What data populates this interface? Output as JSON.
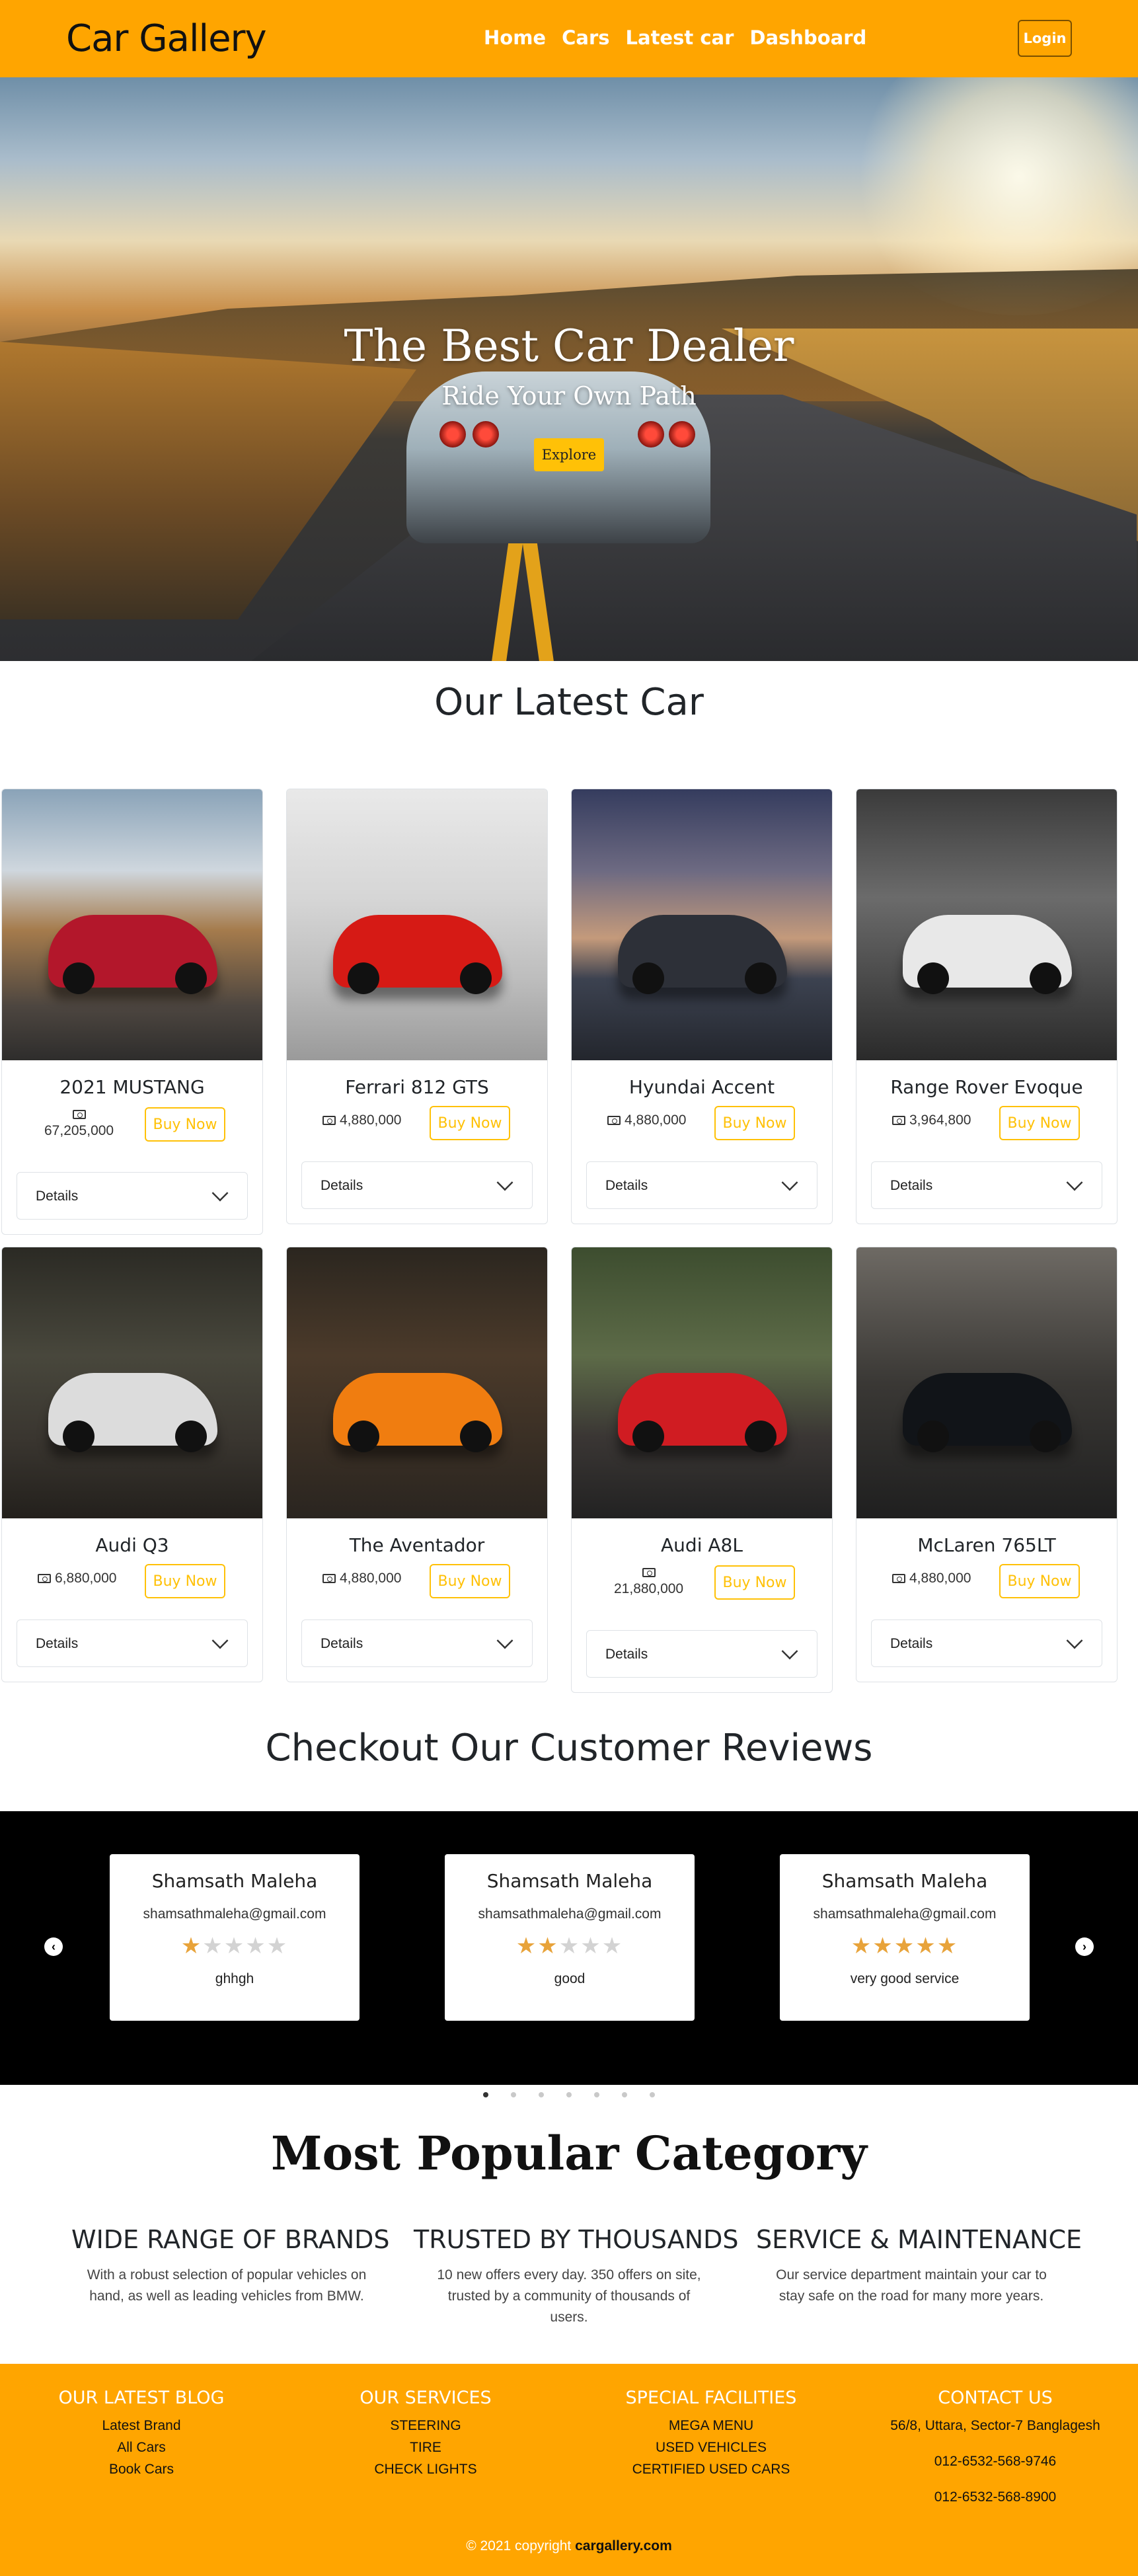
{
  "header": {
    "brand": "Car Gallery",
    "nav": [
      "Home",
      "Cars",
      "Latest car",
      "Dashboard"
    ],
    "login": "Login"
  },
  "hero": {
    "title": "The Best Car Dealer",
    "subtitle": "Ride Your Own Path",
    "button": "Explore"
  },
  "latest": {
    "title": "Our Latest Car",
    "buy_label": "Buy Now",
    "details_label": "Details",
    "cars": [
      {
        "name": "2021 MUSTANG",
        "price": "67,205,000"
      },
      {
        "name": "Ferrari 812 GTS",
        "price": "4,880,000"
      },
      {
        "name": "Hyundai Accent",
        "price": "4,880,000"
      },
      {
        "name": "Range Rover Evoque",
        "price": "3,964,800"
      },
      {
        "name": "Audi Q3",
        "price": "6,880,000"
      },
      {
        "name": "The Aventador",
        "price": "4,880,000"
      },
      {
        "name": "Audi A8L",
        "price": "21,880,000"
      },
      {
        "name": "McLaren 765LT",
        "price": "4,880,000"
      }
    ]
  },
  "reviews": {
    "title": "Checkout Our Customer Reviews",
    "items": [
      {
        "name": "Shamsath Maleha",
        "email": "shamsathmaleha@gmail.com",
        "rating": 1,
        "text": "ghhgh"
      },
      {
        "name": "Shamsath Maleha",
        "email": "shamsathmaleha@gmail.com",
        "rating": 2,
        "text": "good"
      },
      {
        "name": "Shamsath Maleha",
        "email": "shamsathmaleha@gmail.com",
        "rating": 5,
        "text": "very good service"
      }
    ],
    "max_rating": 5,
    "dot_count": 7,
    "active_dot": 0
  },
  "category": {
    "title": "Most Popular Category",
    "items": [
      {
        "heading": "WIDE RANGE OF BRANDS",
        "text": "With a robust selection of popular vehicles on hand, as well as leading vehicles from BMW."
      },
      {
        "heading": "TRUSTED BY THOUSANDS",
        "text": "10 new offers every day. 350 offers on site, trusted by a community of thousands of users."
      },
      {
        "heading": "SERVICE & MAINTENANCE",
        "text": "Our service department maintain your car to stay safe on the road for many more years."
      }
    ]
  },
  "footer": {
    "blog": {
      "title": "OUR LATEST BLOG",
      "items": [
        "Latest Brand",
        "All Cars",
        "Book Cars"
      ]
    },
    "services": {
      "title": "OUR SERVICES",
      "items": [
        "STEERING",
        "TIRE",
        "CHECK LIGHTS"
      ]
    },
    "facilities": {
      "title": "SPECIAL FACILITIES",
      "items": [
        "MEGA MENU",
        "USED VEHICLES",
        "CERTIFIED USED CARS"
      ]
    },
    "contact": {
      "title": "CONTACT US",
      "address": "56/8, Uttara, Sector-7 Banglagesh",
      "phone1": "012-6532-568-9746",
      "phone2": "012-6532-568-8900"
    },
    "copyright_prefix": "© 2021 copyright",
    "copyright_site": "cargallery.com"
  },
  "colors": {
    "brand": "#ffa500",
    "accent": "#ffc107",
    "star": "#e8a33a"
  }
}
